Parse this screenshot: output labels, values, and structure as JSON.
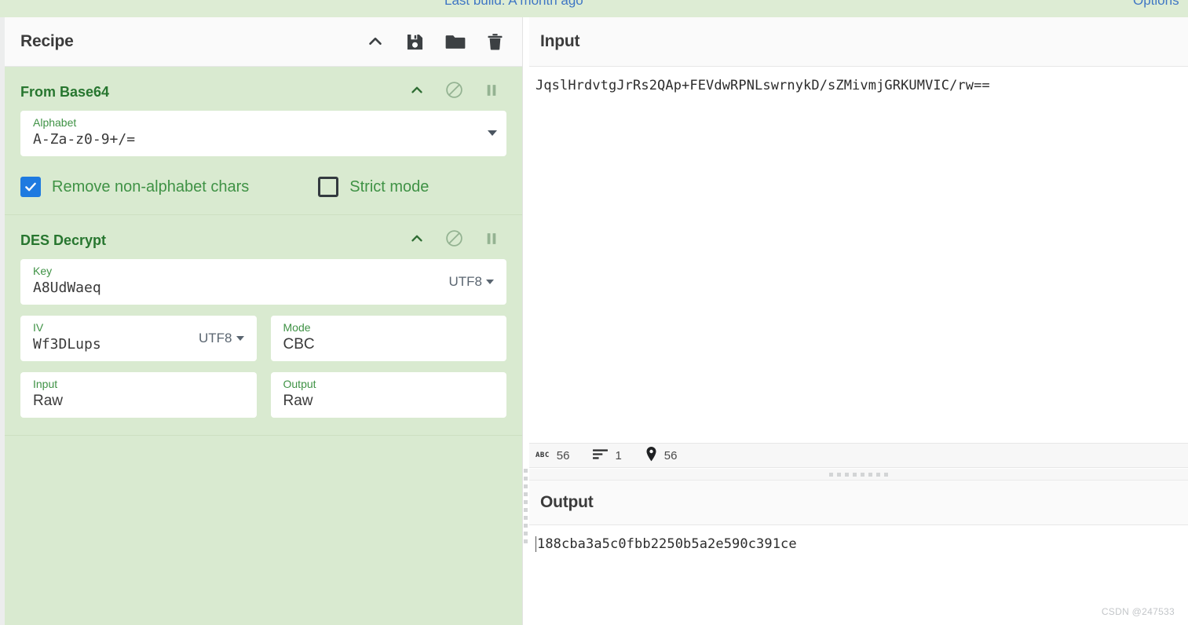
{
  "topbar": {
    "build_text": "Last build: A month ago",
    "options_label": "Options",
    "link_color": "#3f76c4"
  },
  "recipe": {
    "title": "Recipe",
    "icons": [
      {
        "name": "collapse-chevron-icon",
        "label": "Collapse"
      },
      {
        "name": "save-icon",
        "label": "Save recipe"
      },
      {
        "name": "folder-icon",
        "label": "Load recipe"
      },
      {
        "name": "trash-icon",
        "label": "Clear recipe"
      }
    ],
    "operations": [
      {
        "name": "From Base64",
        "controls": [
          "chevron-up-icon",
          "disable-icon",
          "pause-icon"
        ],
        "fields": [
          {
            "label": "Alphabet",
            "value": "A-Za-z0-9+/=",
            "type": "select"
          }
        ],
        "checkboxes": [
          {
            "label": "Remove non-alphabet chars",
            "checked": true
          },
          {
            "label": "Strict mode",
            "checked": false
          }
        ]
      },
      {
        "name": "DES Decrypt",
        "controls": [
          "chevron-up-icon",
          "disable-icon",
          "pause-icon"
        ],
        "fields": [
          {
            "label": "Key",
            "value": "A8UdWaeq",
            "encoding": "UTF8"
          },
          {
            "label": "IV",
            "value": "Wf3DLups",
            "encoding": "UTF8"
          },
          {
            "label": "Mode",
            "value": "CBC"
          },
          {
            "label": "Input",
            "value": "Raw"
          },
          {
            "label": "Output",
            "value": "Raw"
          }
        ]
      }
    ]
  },
  "input": {
    "title": "Input",
    "value": "JqslHrdvtgJrRs2QAp+FEVdwRPNLswrnykD/sZMivmjGRKUMVIC/rw==",
    "status": {
      "length_label": "ABC",
      "length": "56",
      "lines": "1",
      "position": "56"
    }
  },
  "output": {
    "title": "Output",
    "value": "188cba3a5c0fbb2250b5a2e590c391ce"
  },
  "watermark": "CSDN @247533",
  "colors": {
    "recipe_green": "#d9ead0",
    "op_title_green": "#27762f",
    "label_green": "#3f9245",
    "checkbox_blue": "#1e7ae0"
  }
}
